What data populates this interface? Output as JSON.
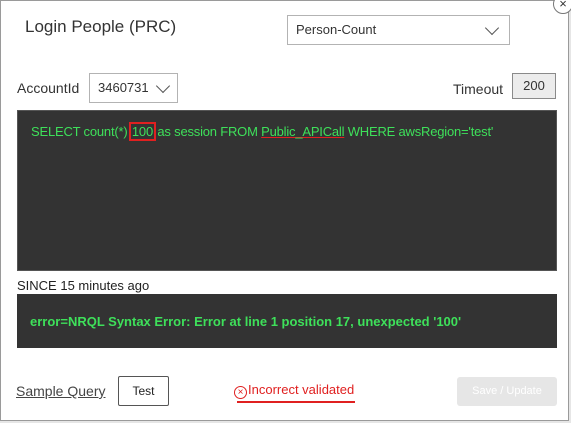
{
  "dialog": {
    "title": "Login People (PRC)",
    "close_symbol": "×",
    "close_icon": "close-icon"
  },
  "query_type": {
    "selected": "Person-Count"
  },
  "account": {
    "label": "AccountId",
    "selected": "3460731"
  },
  "timeout": {
    "label": "Timeout",
    "value": "200"
  },
  "query": {
    "part1": "SELECT count(*) ",
    "highlighted": "100",
    "part2": " as session FROM ",
    "underlined": "Public_APICall",
    "part3": " WHERE awsRegion='test'"
  },
  "since": {
    "text": "SINCE 15 minutes ago"
  },
  "error": {
    "text": "error=NRQL Syntax Error: Error at line 1 position 17, unexpected '100'"
  },
  "footer": {
    "sample_query_label": "Sample Query",
    "test_label": "Test",
    "status_icon": "×",
    "status_text": "Incorrect validated",
    "save_label": "Save / Update"
  },
  "colors": {
    "query_text": "#3ee05a",
    "query_bg": "#333333",
    "error_red": "#e02020"
  }
}
